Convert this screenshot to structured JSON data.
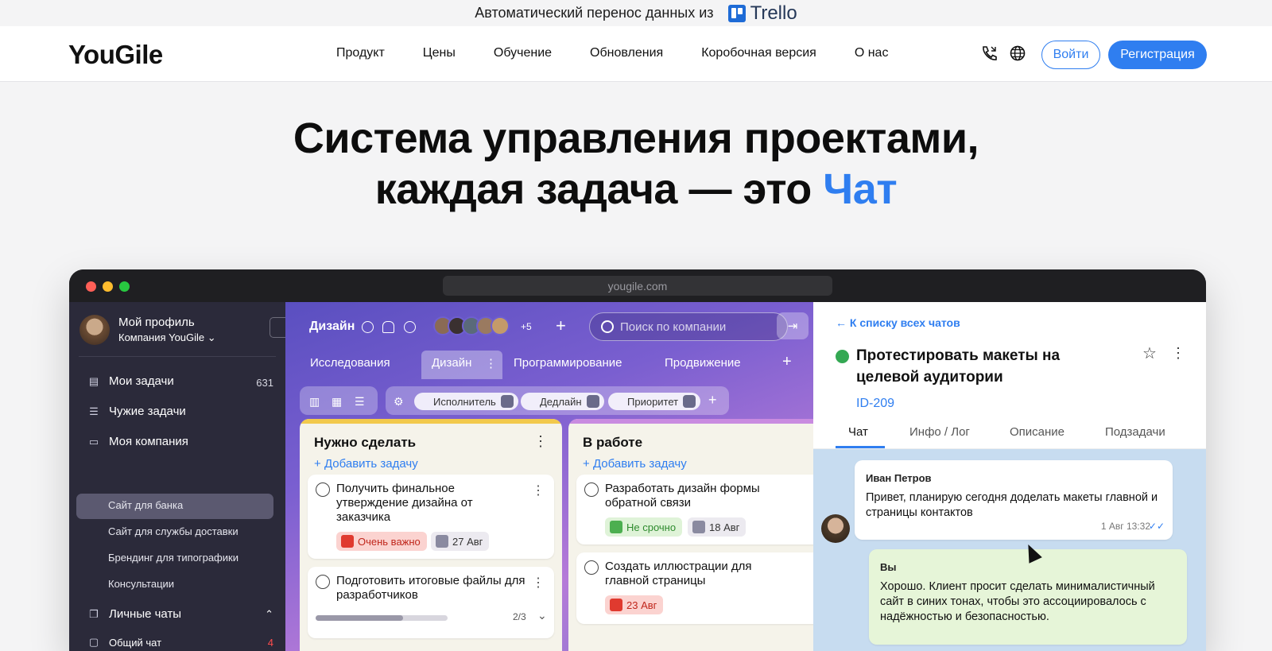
{
  "banner": {
    "text": "Автоматический перенос данных из",
    "brand": "Trello"
  },
  "nav": {
    "logo": "YouGile",
    "links": [
      "Продукт",
      "Цены",
      "Обучение",
      "Обновления",
      "Коробочная версия",
      "О нас"
    ],
    "login": "Войти",
    "register": "Регистрация"
  },
  "hero": {
    "line1": "Система управления проектами,",
    "line2_pre": "каждая задача — это ",
    "line2_accent": "Чат"
  },
  "app": {
    "url": "yougile.com",
    "profile": {
      "name": "Мой профиль",
      "company": "Компания YouGile"
    },
    "sidebar": {
      "my_tasks": "Мои задачи",
      "my_tasks_count": "631",
      "others_tasks": "Чужие задачи",
      "my_company": "Моя компания",
      "projects": [
        "Сайт для банка",
        "Сайт для службы доставки",
        "Брендинг для типографики",
        "Консультации"
      ],
      "personal_chats": "Личные чаты",
      "general_chat": "Общий чат",
      "general_chat_count": "4"
    },
    "board": {
      "title": "Дизайн",
      "avatars_more": "+5",
      "search_placeholder": "Поиск по компании",
      "tabs": [
        "Исследования",
        "Дизайн",
        "Программирование",
        "Продвижение"
      ],
      "filters": [
        "Исполнитель",
        "Дедлайн",
        "Приоритет"
      ],
      "columns": [
        {
          "title": "Нужно сделать",
          "add": "Добавить задачу",
          "cards": [
            {
              "text": "Получить финальное утверждение дизайна от заказчика",
              "tag": "Очень важно",
              "date": "27 Авг"
            },
            {
              "text": "Подготовить итоговые файлы для разработчиков",
              "progress": "2/3"
            }
          ]
        },
        {
          "title": "В работе",
          "add": "Добавить задачу",
          "cards": [
            {
              "text": "Разработать дизайн формы обратной связи",
              "tag": "Не срочно",
              "date": "18 Авг"
            },
            {
              "text": "Создать иллюстрации для главной страницы",
              "date": "23 Авг"
            }
          ]
        }
      ]
    },
    "chat": {
      "back": "К списку всех чатов",
      "title": "Протестировать макеты на целевой аудитории",
      "id": "ID-209",
      "tabs": [
        "Чат",
        "Инфо / Лог",
        "Описание",
        "Подзадачи"
      ],
      "messages": [
        {
          "author": "Иван Петров",
          "text": "Привет, планирую сегодня доделать макеты главной и страницы контактов",
          "time": "1 Авг 13:32"
        },
        {
          "author": "Вы",
          "text": "Хорошо. Клиент просит сделать минималистичный сайт в синих тонах, чтобы это ассоциировалось с надёжностью и безопасностью."
        }
      ]
    }
  },
  "colors": {
    "accent": "#2f7ef0",
    "important": "#e03a2f",
    "low": "#4caf50"
  }
}
